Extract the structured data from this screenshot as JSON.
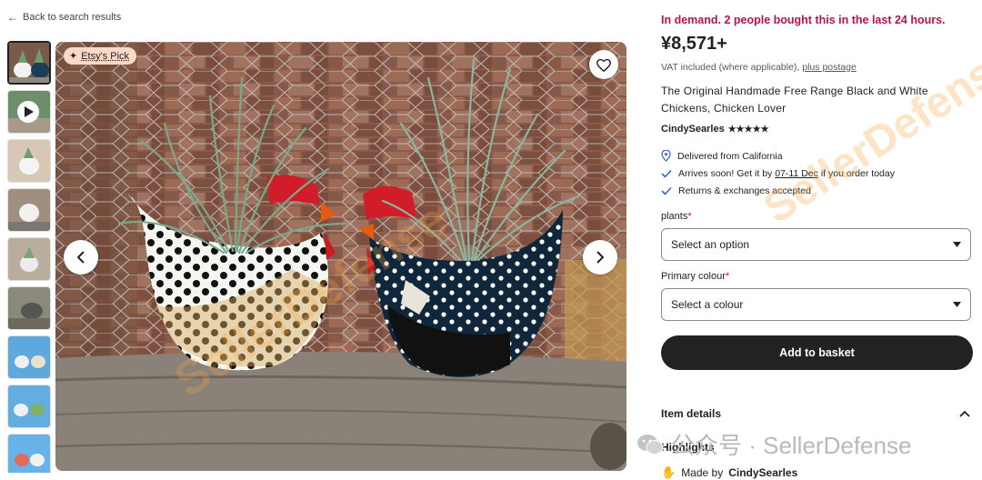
{
  "nav": {
    "back_label": "Back to search results"
  },
  "gallery": {
    "badge_label": "Etsy's Pick",
    "thumbnail_count": 9
  },
  "product": {
    "demand_text": "In demand. 2 people bought this in the last 24 hours.",
    "price": "¥8,571+",
    "vat_text": "VAT included (where applicable),",
    "postage_link": "plus postage",
    "title": "The Original Handmade Free Range Black and White Chickens, Chicken Lover",
    "seller": "CindySearles",
    "rating_stars": "★★★★★",
    "features": [
      {
        "icon": "location-pin-icon",
        "text": "Delivered from California"
      },
      {
        "icon": "checkmark-icon",
        "text_before": "Arrives soon! Get it by",
        "date": "07-11 Dec",
        "text_after": "if you order today"
      },
      {
        "icon": "checkmark-icon",
        "text": "Returns & exchanges accepted"
      }
    ]
  },
  "options": {
    "plants_label": "plants",
    "plants_value": "Select an option",
    "colour_label": "Primary colour",
    "colour_value": "Select a colour",
    "required_mark": "*"
  },
  "actions": {
    "add_to_basket": "Add to basket"
  },
  "details": {
    "item_details_label": "Item details",
    "highlights_label": "Highlights",
    "made_by_prefix": "Made by",
    "made_by_name": "CindySearles"
  },
  "watermark": {
    "brand": "SellerDefense",
    "bottom_text": "公众号 · SellerDefense",
    "diag_text": "SellerDefense"
  },
  "colors": {
    "demand": "#b4144f",
    "button": "#222222",
    "badge": "#fcd9c6"
  }
}
